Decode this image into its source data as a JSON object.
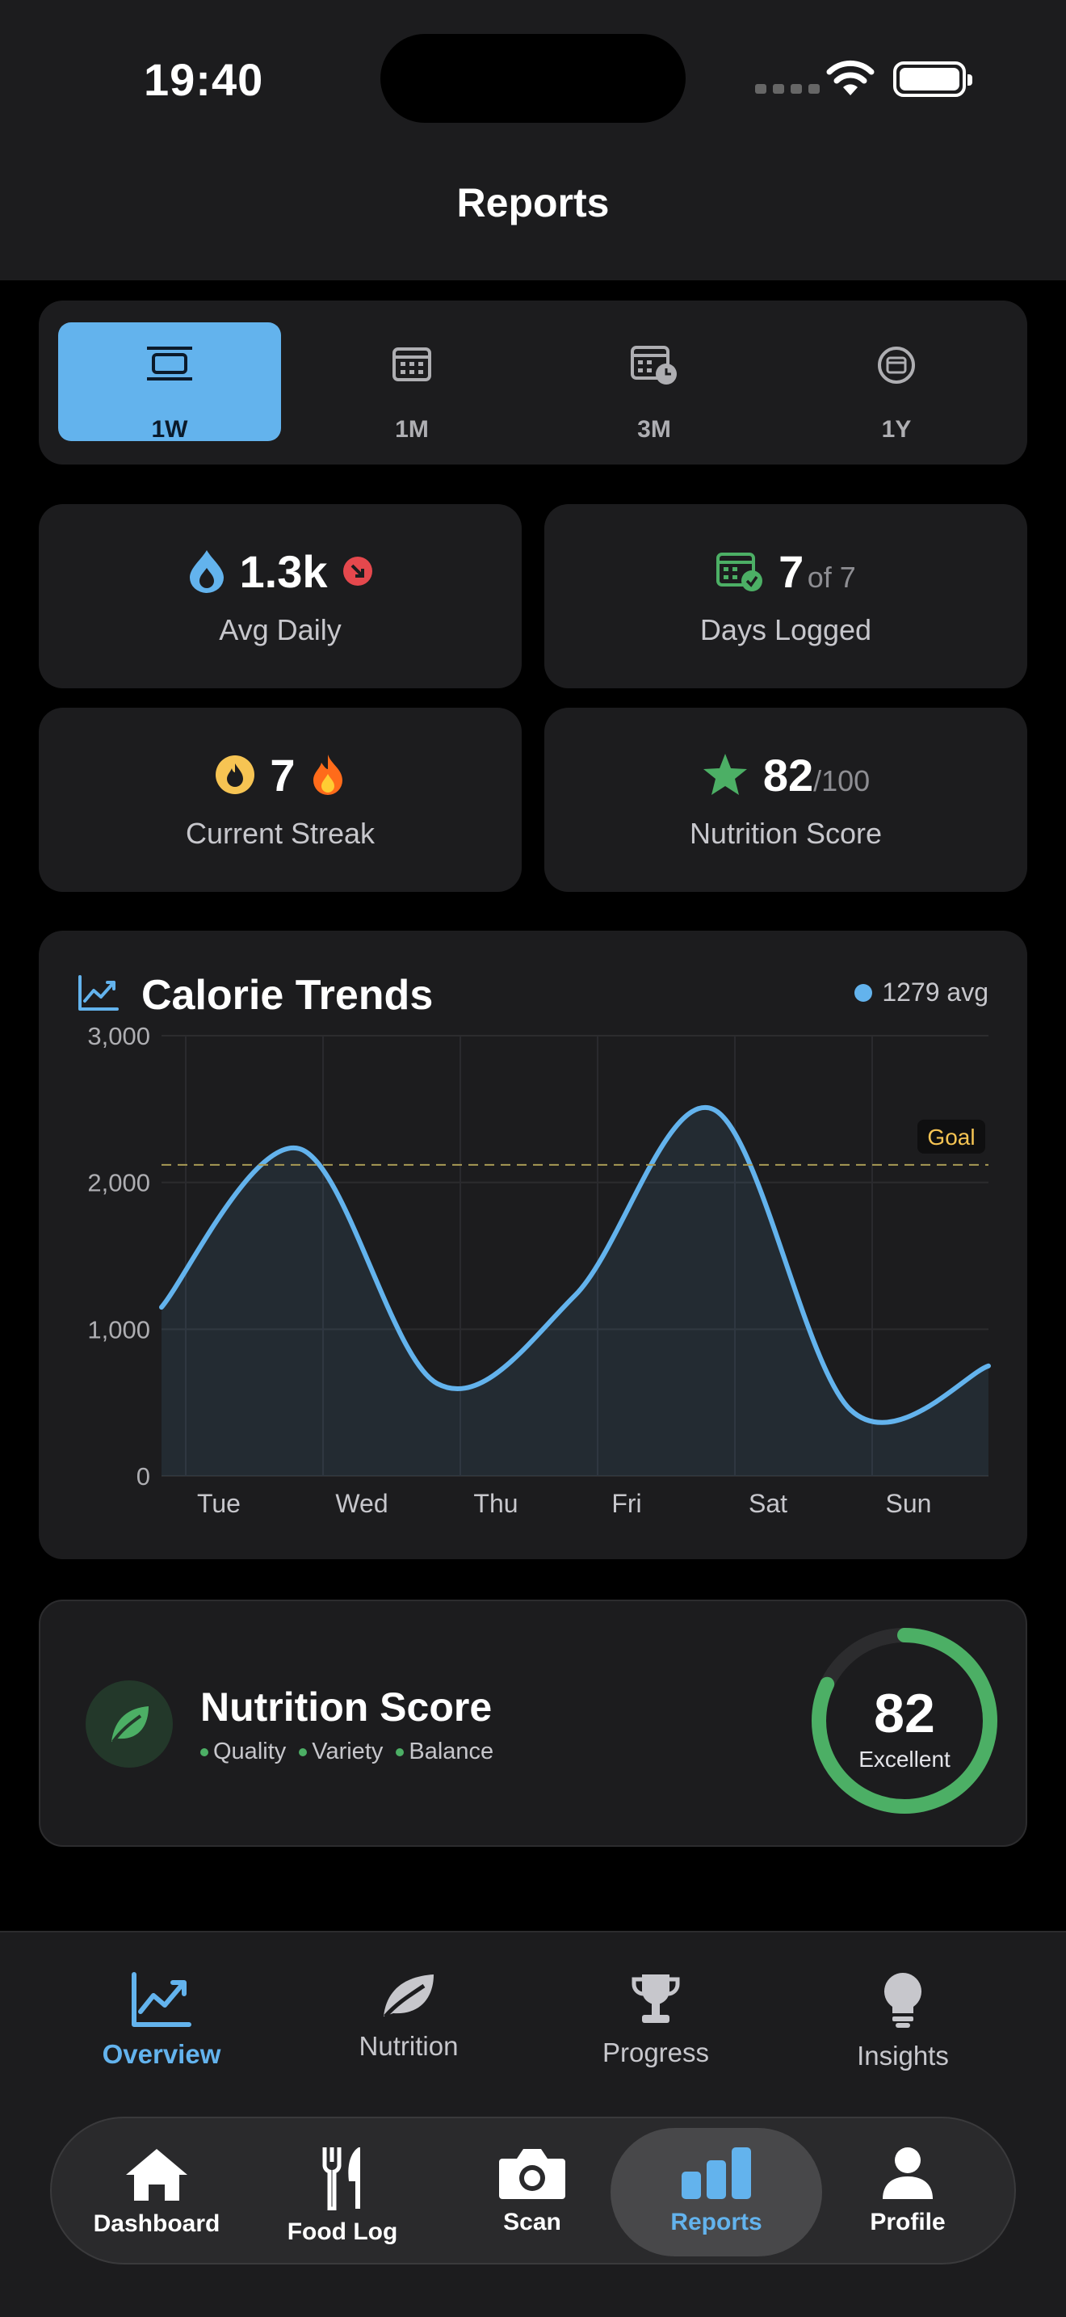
{
  "status": {
    "time": "19:40"
  },
  "header": {
    "title": "Reports"
  },
  "range": {
    "options": [
      {
        "label": "1W",
        "icon": "list-icon",
        "active": true
      },
      {
        "label": "1M",
        "icon": "calendar-icon",
        "active": false
      },
      {
        "label": "3M",
        "icon": "calendar-clock-icon",
        "active": false
      },
      {
        "label": "1Y",
        "icon": "calendar-circle-icon",
        "active": false
      }
    ]
  },
  "stats": {
    "avg_daily": {
      "value": "1.3k",
      "label": "Avg Daily"
    },
    "days_logged": {
      "value": "7",
      "suffix": "of 7",
      "label": "Days Logged"
    },
    "streak": {
      "value": "7",
      "label": "Current Streak"
    },
    "nutrition_score": {
      "value": "82",
      "suffix": "/100",
      "label": "Nutrition Score"
    }
  },
  "chart_data": {
    "type": "area",
    "title": "Calorie Trends",
    "legend": "1279 avg",
    "goal_label": "Goal",
    "goal_value": 2120,
    "categories": [
      "Tue",
      "Wed",
      "Thu",
      "Fri",
      "Sat",
      "Sun"
    ],
    "y_ticks": [
      "3,000",
      "2,000",
      "1,000",
      "0"
    ],
    "ylim": [
      0,
      3000
    ],
    "x": [
      0,
      1,
      2,
      3,
      4,
      5,
      6
    ],
    "values": [
      1150,
      2230,
      630,
      1230,
      2500,
      450,
      750
    ],
    "grid": true,
    "accent": "#63b3ed"
  },
  "score_card": {
    "title": "Nutrition Score",
    "tags": [
      "Quality",
      "Variety",
      "Balance"
    ],
    "score": "82",
    "score_fraction": 0.82,
    "rating": "Excellent"
  },
  "subtabs": [
    {
      "label": "Overview",
      "icon": "trend-chart-icon",
      "active": true
    },
    {
      "label": "Nutrition",
      "icon": "leaf-icon",
      "active": false
    },
    {
      "label": "Progress",
      "icon": "trophy-icon",
      "active": false
    },
    {
      "label": "Insights",
      "icon": "lightbulb-icon",
      "active": false
    }
  ],
  "tabbar": [
    {
      "label": "Dashboard",
      "icon": "home-icon",
      "active": false
    },
    {
      "label": "Food Log",
      "icon": "fork-knife-icon",
      "active": false
    },
    {
      "label": "Scan",
      "icon": "camera-icon",
      "active": false
    },
    {
      "label": "Reports",
      "icon": "bar-chart-icon",
      "active": true
    },
    {
      "label": "Profile",
      "icon": "person-icon",
      "active": false
    }
  ]
}
